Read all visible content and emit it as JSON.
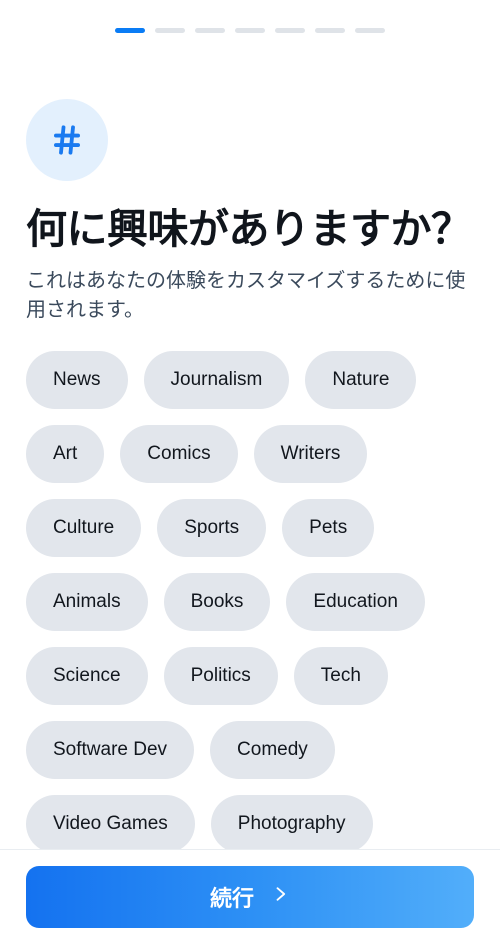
{
  "progress": {
    "total_steps": 7,
    "current_step": 1
  },
  "header": {
    "icon": "hashtag-icon",
    "title": "何に興味がありますか？",
    "subtitle": "これはあなたの体験をカスタマイズするために使用されます。"
  },
  "interests": [
    {
      "label": "News",
      "selected": false
    },
    {
      "label": "Journalism",
      "selected": false
    },
    {
      "label": "Nature",
      "selected": false
    },
    {
      "label": "Art",
      "selected": false
    },
    {
      "label": "Comics",
      "selected": false
    },
    {
      "label": "Writers",
      "selected": false
    },
    {
      "label": "Culture",
      "selected": false
    },
    {
      "label": "Sports",
      "selected": false
    },
    {
      "label": "Pets",
      "selected": false
    },
    {
      "label": "Animals",
      "selected": false
    },
    {
      "label": "Books",
      "selected": false
    },
    {
      "label": "Education",
      "selected": false
    },
    {
      "label": "Science",
      "selected": false
    },
    {
      "label": "Politics",
      "selected": false
    },
    {
      "label": "Tech",
      "selected": false
    },
    {
      "label": "Software Dev",
      "selected": false
    },
    {
      "label": "Comedy",
      "selected": false
    },
    {
      "label": "Video Games",
      "selected": false
    },
    {
      "label": "Photography",
      "selected": false
    }
  ],
  "footer": {
    "continue_label": "続行",
    "continue_icon": "chevron-right-icon"
  },
  "colors": {
    "accent": "#0a7cf5",
    "accent_light": "#52aefa",
    "icon_badge_bg": "#e3f0fd",
    "chip_bg": "#e2e6ec",
    "chip_text": "#12171e",
    "title_text": "#10151c",
    "subtitle_text": "#3b4a5c",
    "progress_inactive": "#dfe3e8",
    "page_bg": "#ffffff"
  }
}
